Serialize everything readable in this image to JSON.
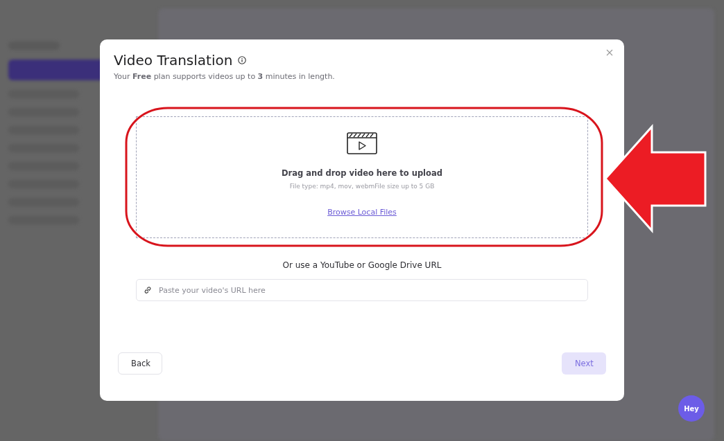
{
  "dialog": {
    "title": "Video Translation",
    "subtitle": "Your **Free** plan supports videos up to **3** minutes in length.",
    "dropzone": {
      "heading": "Drag and drop video here to upload",
      "hint": "File type: mp4, mov, webmFile size up to 5 GB",
      "browse_link": "Browse Local Files"
    },
    "url_label": "Or use a YouTube or Google Drive URL",
    "url_field": {
      "placeholder": "Paste your video's URL here"
    },
    "buttons": [
      {
        "label": "Back",
        "kind": "secondary",
        "disabled": false
      },
      {
        "label": "Next",
        "kind": "primary",
        "disabled": true
      }
    ]
  },
  "chat_bubble": "Hey"
}
